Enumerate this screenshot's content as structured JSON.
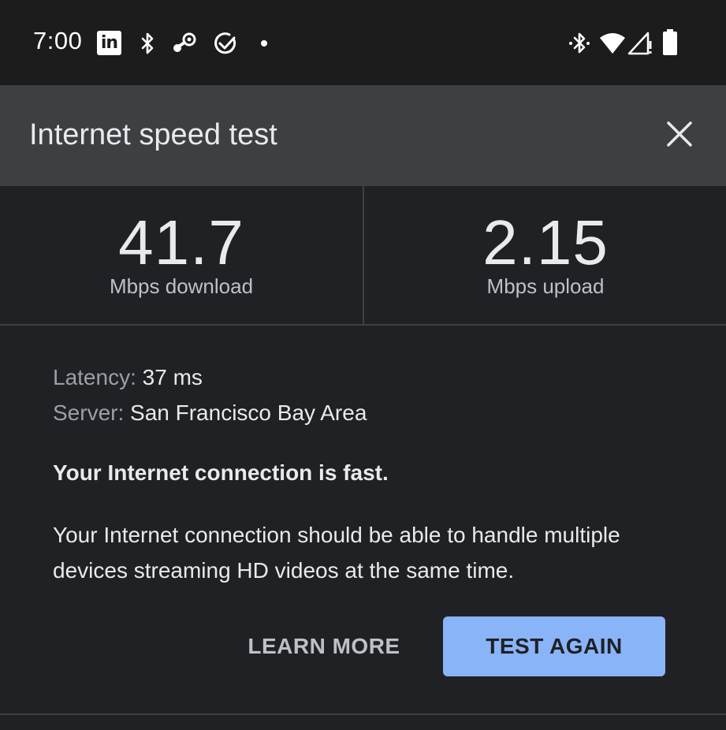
{
  "status_bar": {
    "time": "7:00",
    "left_icons": [
      "linkedin-icon",
      "bluetooth-icon",
      "steam-icon",
      "check-circle-icon",
      "notification-dot-icon"
    ],
    "right_icons": [
      "bluetooth-connected-icon",
      "wifi-icon",
      "cell-signal-icon",
      "battery-icon"
    ],
    "linkedin_glyph": "in"
  },
  "header": {
    "title": "Internet speed test",
    "close_icon": "close-icon"
  },
  "results": {
    "download_value": "41.7",
    "download_unit": "Mbps download",
    "upload_value": "2.15",
    "upload_unit": "Mbps upload"
  },
  "details": {
    "latency_label": "Latency:",
    "latency_value": "37 ms",
    "server_label": "Server:",
    "server_value": "San Francisco Bay Area"
  },
  "verdict": "Your Internet connection is fast.",
  "description": "Your Internet connection should be able to handle multiple devices streaming HD videos at the same time.",
  "actions": {
    "learn_more": "LEARN MORE",
    "test_again": "TEST AGAIN"
  },
  "colors": {
    "background": "#202124",
    "header_background": "#3c4043",
    "status_bar_background": "#1c1c1d",
    "accent_button": "#8ab4f8"
  }
}
